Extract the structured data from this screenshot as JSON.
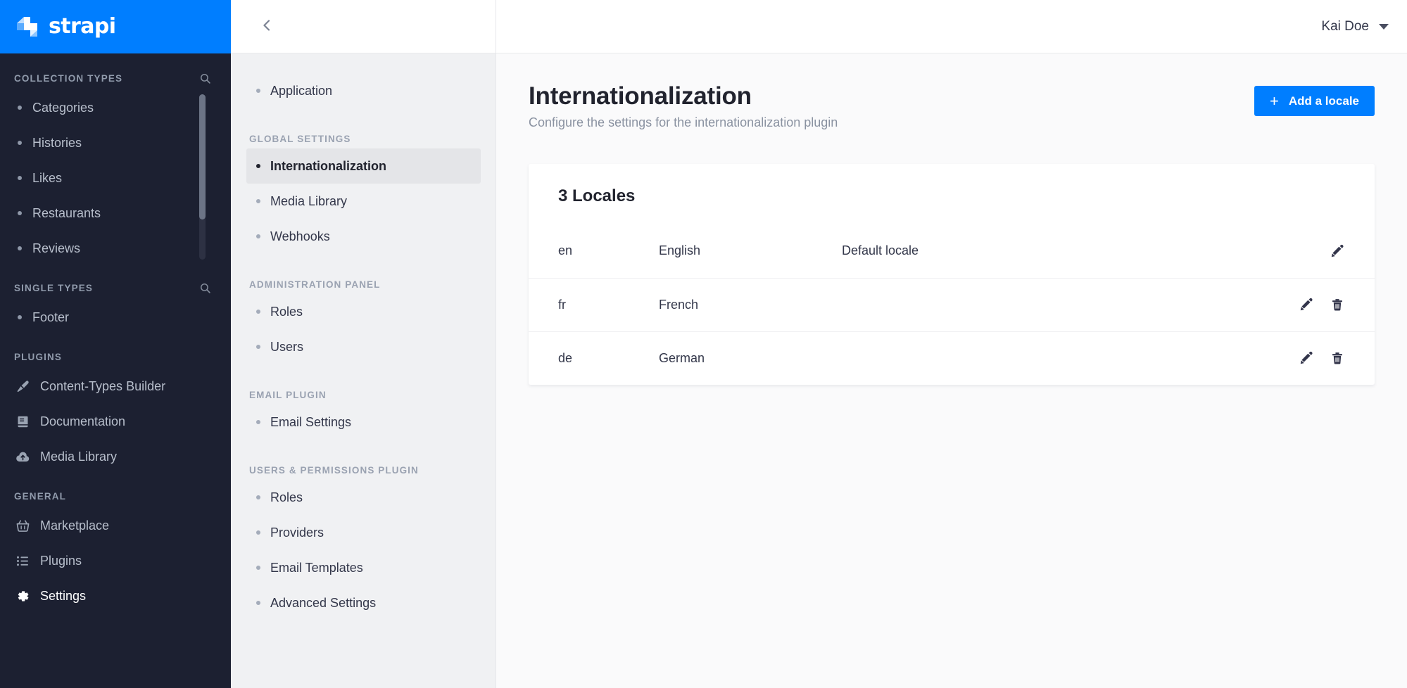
{
  "brand": {
    "name": "strapi",
    "logo_icon": "strapi-logo-mark",
    "bg": "#007eff"
  },
  "sidebar": {
    "sections": [
      {
        "title": "COLLECTION TYPES",
        "search_icon": "search-icon",
        "has_search": true,
        "items": [
          {
            "label": "Categories",
            "icon": "bullet-icon"
          },
          {
            "label": "Histories",
            "icon": "bullet-icon"
          },
          {
            "label": "Likes",
            "icon": "bullet-icon"
          },
          {
            "label": "Restaurants",
            "icon": "bullet-icon"
          },
          {
            "label": "Reviews",
            "icon": "bullet-icon"
          }
        ]
      },
      {
        "title": "SINGLE TYPES",
        "search_icon": "search-icon",
        "has_search": true,
        "items": [
          {
            "label": "Footer",
            "icon": "bullet-icon"
          }
        ]
      },
      {
        "title": "PLUGINS",
        "has_search": false,
        "items": [
          {
            "label": "Content-Types Builder",
            "icon": "paintbrush-icon"
          },
          {
            "label": "Documentation",
            "icon": "book-icon"
          },
          {
            "label": "Media Library",
            "icon": "cloud-upload-icon"
          }
        ]
      },
      {
        "title": "GENERAL",
        "has_search": false,
        "items": [
          {
            "label": "Marketplace",
            "icon": "shopping-basket-icon"
          },
          {
            "label": "Plugins",
            "icon": "list-icon"
          },
          {
            "label": "Settings",
            "icon": "gear-icon",
            "active": true
          }
        ]
      }
    ]
  },
  "subnav": {
    "back_icon": "chevron-left-icon",
    "groups": [
      {
        "title": "",
        "items": [
          {
            "label": "Application"
          }
        ]
      },
      {
        "title": "GLOBAL SETTINGS",
        "items": [
          {
            "label": "Internationalization",
            "active": true
          },
          {
            "label": "Media Library"
          },
          {
            "label": "Webhooks"
          }
        ]
      },
      {
        "title": "ADMINISTRATION PANEL",
        "items": [
          {
            "label": "Roles"
          },
          {
            "label": "Users"
          }
        ]
      },
      {
        "title": "EMAIL PLUGIN",
        "items": [
          {
            "label": "Email Settings"
          }
        ]
      },
      {
        "title": "USERS & PERMISSIONS PLUGIN",
        "items": [
          {
            "label": "Roles"
          },
          {
            "label": "Providers"
          },
          {
            "label": "Email Templates"
          },
          {
            "label": "Advanced Settings"
          }
        ]
      }
    ]
  },
  "topbar": {
    "user_name": "Kai Doe",
    "caret_icon": "chevron-down-icon"
  },
  "page": {
    "title": "Internationalization",
    "subtitle": "Configure the settings for the internationalization plugin",
    "add_button_label": "Add a locale",
    "add_button_icon": "plus-icon",
    "accent_color": "#007eff"
  },
  "locales_card": {
    "title": "3 Locales",
    "rows": [
      {
        "code": "en",
        "name": "English",
        "status": "Default locale",
        "actions": [
          "edit-icon"
        ]
      },
      {
        "code": "fr",
        "name": "French",
        "status": "",
        "actions": [
          "edit-icon",
          "delete-icon"
        ]
      },
      {
        "code": "de",
        "name": "German",
        "status": "",
        "actions": [
          "edit-icon",
          "delete-icon"
        ]
      }
    ]
  }
}
